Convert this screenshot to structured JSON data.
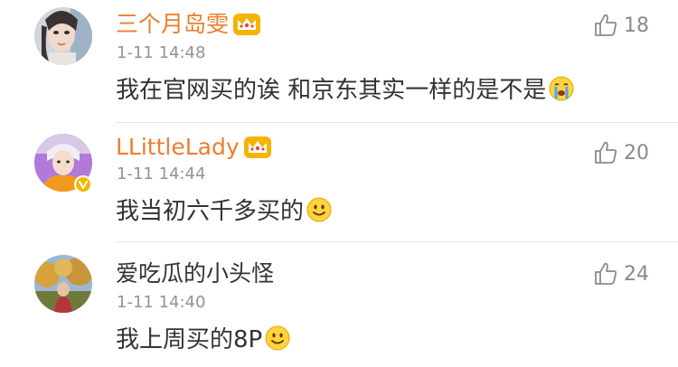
{
  "comments": [
    {
      "username": "三个月岛雯",
      "timestamp": "1-11 14:48",
      "text": "我在官网买的诶 和京东其实一样的是不是",
      "likes": "18",
      "vip": true,
      "verified": false,
      "emoji": "crying-emoji"
    },
    {
      "username": "LLittleLady",
      "timestamp": "1-11 14:44",
      "text": "我当初六千多买的",
      "likes": "20",
      "vip": true,
      "verified": true,
      "emoji": "smile-emoji"
    },
    {
      "username": "爱吃瓜的小头怪",
      "timestamp": "1-11 14:40",
      "text": "我上周买的8P",
      "likes": "24",
      "vip": false,
      "verified": false,
      "emoji": "smile-emoji"
    }
  ],
  "colors": {
    "vip_name": "#ee7d2c",
    "normal_name": "#333333",
    "timestamp": "#939393",
    "like": "#8a8a8a",
    "divider": "#e6e6e6",
    "badge": "#f7b500"
  },
  "icons": {
    "like": "thumbs-up-outline-icon",
    "vip": "crown-icon",
    "verified": "verified-v-icon"
  }
}
